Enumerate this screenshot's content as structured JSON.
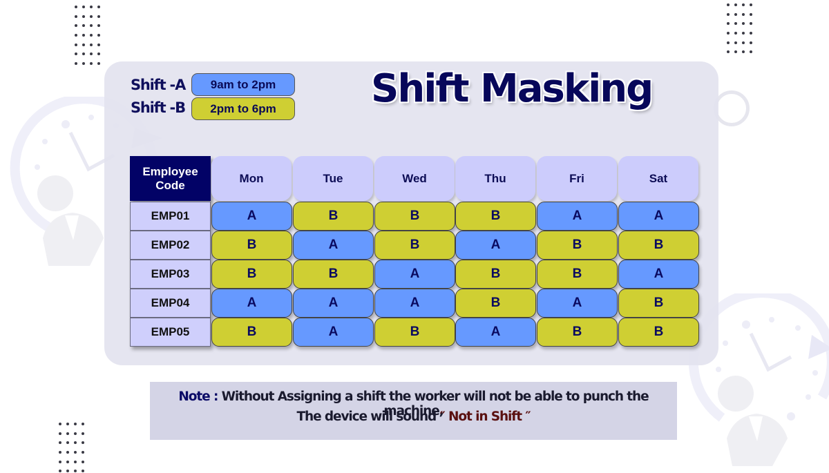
{
  "title": "Shift Masking",
  "legend": [
    {
      "label": "Shift -A",
      "time": "9am to 2pm",
      "code": "A",
      "color": "#6699ff"
    },
    {
      "label": "Shift -B",
      "time": "2pm to 6pm",
      "code": "B",
      "color": "#cfcf33"
    }
  ],
  "table": {
    "corner_header": "Employee Code",
    "days": [
      "Mon",
      "Tue",
      "Wed",
      "Thu",
      "Fri",
      "Sat"
    ],
    "rows": [
      {
        "code": "EMP01",
        "shifts": [
          "A",
          "B",
          "B",
          "B",
          "A",
          "A"
        ]
      },
      {
        "code": "EMP02",
        "shifts": [
          "B",
          "A",
          "B",
          "A",
          "B",
          "B"
        ]
      },
      {
        "code": "EMP03",
        "shifts": [
          "B",
          "B",
          "A",
          "B",
          "B",
          "A"
        ]
      },
      {
        "code": "EMP04",
        "shifts": [
          "A",
          "A",
          "A",
          "B",
          "A",
          "B"
        ]
      },
      {
        "code": "EMP05",
        "shifts": [
          "B",
          "A",
          "B",
          "A",
          "B",
          "B"
        ]
      }
    ]
  },
  "note": {
    "prefix": "Note :",
    "line1": " Without Assigning a shift the worker will not be able to punch the machine,",
    "line2_prefix": "The device will sound ",
    "open_quote": "″ ",
    "quoted": "Not in Shift",
    "close_quote": " ″"
  },
  "decor": {
    "icons": [
      "dot-grid-icon",
      "clock-employee-icon",
      "ring-icon"
    ]
  }
}
